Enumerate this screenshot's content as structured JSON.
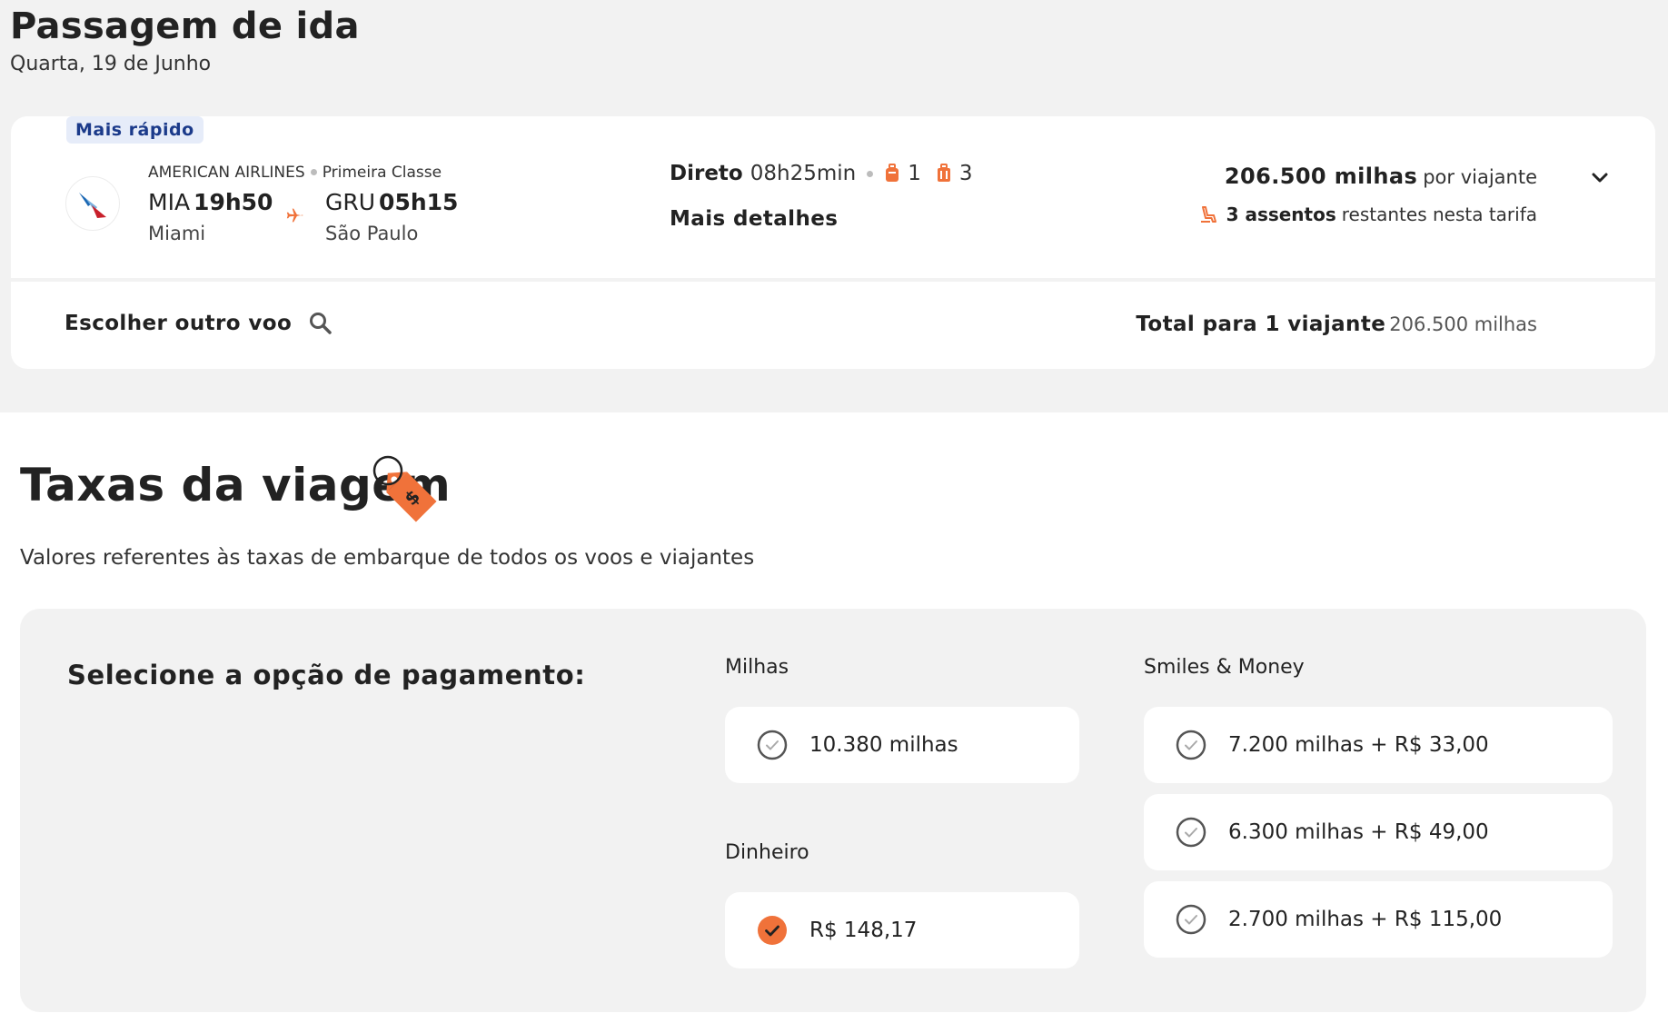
{
  "header": {
    "title": "Passagem de ida",
    "date": "Quarta, 19 de Junho"
  },
  "flight": {
    "badge": "Mais rápido",
    "airline": "AMERICAN AIRLINES",
    "cabin": "Primeira Classe",
    "origin": {
      "code": "MIA",
      "time": "19h50",
      "city": "Miami"
    },
    "destination": {
      "code": "GRU",
      "time": "05h15",
      "city": "São Paulo"
    },
    "stops_label": "Direto",
    "duration": "08h25min",
    "carry_on_count": "1",
    "checked_bags_count": "3",
    "more_details": "Mais detalhes",
    "price_miles": "206.500 milhas",
    "price_suffix": "por viajante",
    "seats_strong": "3 assentos",
    "seats_suffix": "restantes nesta tarifa"
  },
  "footer": {
    "choose_other": "Escolher outro voo",
    "total_label": "Total para 1 viajante",
    "total_value": "206.500 milhas"
  },
  "fees": {
    "title": "Taxas da viagem",
    "subtitle": "Valores referentes às taxas de embarque de todos os voos e viajantes",
    "payment_label": "Selecione a opção de pagamento:",
    "miles_group": {
      "label": "Milhas",
      "options": [
        {
          "text": "10.380 milhas",
          "selected": false
        }
      ]
    },
    "cash_group": {
      "label": "Dinheiro",
      "options": [
        {
          "text": "R$ 148,17",
          "selected": true
        }
      ]
    },
    "smiles_money_group": {
      "label": "Smiles & Money",
      "options": [
        {
          "text": "7.200 milhas + R$ 33,00",
          "selected": false
        },
        {
          "text": "6.300 milhas + R$ 49,00",
          "selected": false
        },
        {
          "text": "2.700 milhas + R$ 115,00",
          "selected": false
        }
      ]
    }
  },
  "colors": {
    "accent": "#f0723a",
    "badge_bg": "#e6ecf9",
    "badge_text": "#1b3a8a",
    "page_bg": "#f2f2f2"
  },
  "icons": {
    "airline_logo": "american-airlines-logo",
    "plane": "plane-icon",
    "carry_on": "carry-on-bag-icon",
    "checked_bag": "checked-bag-icon",
    "seat": "seat-icon",
    "chevron": "chevron-down-icon",
    "search": "search-icon",
    "tag": "price-tag-icon"
  }
}
